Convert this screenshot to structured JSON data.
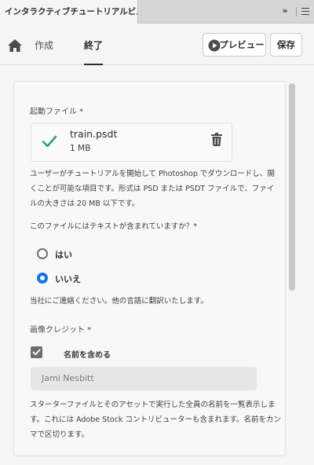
{
  "panel": {
    "tab_title": "インタラクティブチュートリアルビルダー",
    "collapse_glyph": "»"
  },
  "header": {
    "tabs": [
      {
        "label": "作成"
      },
      {
        "label": "終了"
      }
    ],
    "preview_label": "プレビュー",
    "save_label": "保存"
  },
  "form": {
    "start_file_label": "起動ファイル *",
    "file": {
      "name": "train.psdt",
      "size": "1 MB"
    },
    "description": "ユーザーがチュートリアルを開始して Photoshop でダウンロードし、開くことが可能な項目です。形式は PSD または PSDT ファイルで、ファイルの大きさは 20 MB 以下です。",
    "question_label": "このファイルにはテキストが含まれていますか？*",
    "options": [
      {
        "label": "はい",
        "selected": false
      },
      {
        "label": "いいえ",
        "selected": true
      }
    ],
    "contact_note": "当社にご連絡ください。他の言語に翻訳いたします。",
    "credit_label": "画像クレジット *",
    "include_name_label": "名前を含める",
    "include_name_checked": true,
    "credit_input_value": "Jami Nesbitt",
    "credit_description": "スターターファイルとそのアセットで実行した全員の名前を一覧表示します。これには Adobe Stock コントリビューターも含まれます。名前をカンマで区切ります。"
  },
  "colors": {
    "accent": "#1473e6",
    "check": "#2d9d78"
  }
}
